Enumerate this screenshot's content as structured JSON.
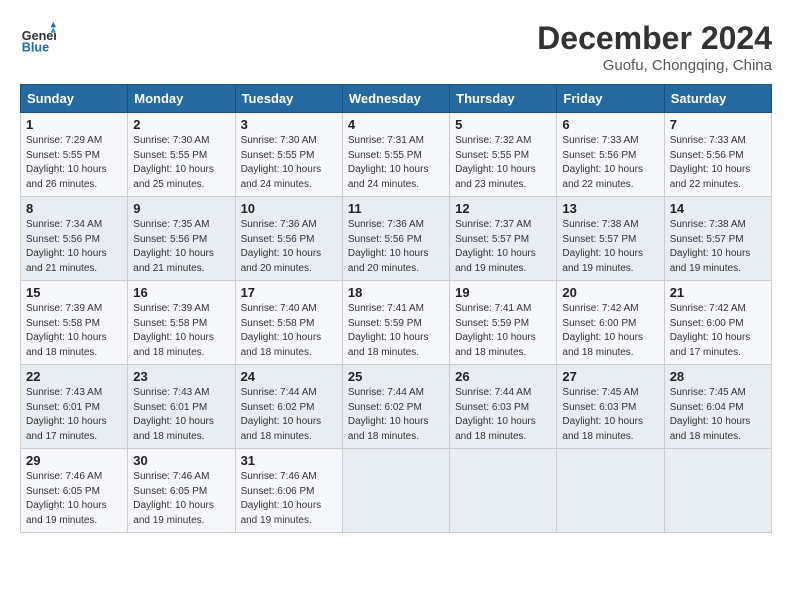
{
  "header": {
    "logo_line1": "General",
    "logo_line2": "Blue",
    "month": "December 2024",
    "location": "Guofu, Chongqing, China"
  },
  "weekdays": [
    "Sunday",
    "Monday",
    "Tuesday",
    "Wednesday",
    "Thursday",
    "Friday",
    "Saturday"
  ],
  "weeks": [
    [
      {
        "day": "1",
        "info": "Sunrise: 7:29 AM\nSunset: 5:55 PM\nDaylight: 10 hours\nand 26 minutes."
      },
      {
        "day": "2",
        "info": "Sunrise: 7:30 AM\nSunset: 5:55 PM\nDaylight: 10 hours\nand 25 minutes."
      },
      {
        "day": "3",
        "info": "Sunrise: 7:30 AM\nSunset: 5:55 PM\nDaylight: 10 hours\nand 24 minutes."
      },
      {
        "day": "4",
        "info": "Sunrise: 7:31 AM\nSunset: 5:55 PM\nDaylight: 10 hours\nand 24 minutes."
      },
      {
        "day": "5",
        "info": "Sunrise: 7:32 AM\nSunset: 5:55 PM\nDaylight: 10 hours\nand 23 minutes."
      },
      {
        "day": "6",
        "info": "Sunrise: 7:33 AM\nSunset: 5:56 PM\nDaylight: 10 hours\nand 22 minutes."
      },
      {
        "day": "7",
        "info": "Sunrise: 7:33 AM\nSunset: 5:56 PM\nDaylight: 10 hours\nand 22 minutes."
      }
    ],
    [
      {
        "day": "8",
        "info": "Sunrise: 7:34 AM\nSunset: 5:56 PM\nDaylight: 10 hours\nand 21 minutes."
      },
      {
        "day": "9",
        "info": "Sunrise: 7:35 AM\nSunset: 5:56 PM\nDaylight: 10 hours\nand 21 minutes."
      },
      {
        "day": "10",
        "info": "Sunrise: 7:36 AM\nSunset: 5:56 PM\nDaylight: 10 hours\nand 20 minutes."
      },
      {
        "day": "11",
        "info": "Sunrise: 7:36 AM\nSunset: 5:56 PM\nDaylight: 10 hours\nand 20 minutes."
      },
      {
        "day": "12",
        "info": "Sunrise: 7:37 AM\nSunset: 5:57 PM\nDaylight: 10 hours\nand 19 minutes."
      },
      {
        "day": "13",
        "info": "Sunrise: 7:38 AM\nSunset: 5:57 PM\nDaylight: 10 hours\nand 19 minutes."
      },
      {
        "day": "14",
        "info": "Sunrise: 7:38 AM\nSunset: 5:57 PM\nDaylight: 10 hours\nand 19 minutes."
      }
    ],
    [
      {
        "day": "15",
        "info": "Sunrise: 7:39 AM\nSunset: 5:58 PM\nDaylight: 10 hours\nand 18 minutes."
      },
      {
        "day": "16",
        "info": "Sunrise: 7:39 AM\nSunset: 5:58 PM\nDaylight: 10 hours\nand 18 minutes."
      },
      {
        "day": "17",
        "info": "Sunrise: 7:40 AM\nSunset: 5:58 PM\nDaylight: 10 hours\nand 18 minutes."
      },
      {
        "day": "18",
        "info": "Sunrise: 7:41 AM\nSunset: 5:59 PM\nDaylight: 10 hours\nand 18 minutes."
      },
      {
        "day": "19",
        "info": "Sunrise: 7:41 AM\nSunset: 5:59 PM\nDaylight: 10 hours\nand 18 minutes."
      },
      {
        "day": "20",
        "info": "Sunrise: 7:42 AM\nSunset: 6:00 PM\nDaylight: 10 hours\nand 18 minutes."
      },
      {
        "day": "21",
        "info": "Sunrise: 7:42 AM\nSunset: 6:00 PM\nDaylight: 10 hours\nand 17 minutes."
      }
    ],
    [
      {
        "day": "22",
        "info": "Sunrise: 7:43 AM\nSunset: 6:01 PM\nDaylight: 10 hours\nand 17 minutes."
      },
      {
        "day": "23",
        "info": "Sunrise: 7:43 AM\nSunset: 6:01 PM\nDaylight: 10 hours\nand 18 minutes."
      },
      {
        "day": "24",
        "info": "Sunrise: 7:44 AM\nSunset: 6:02 PM\nDaylight: 10 hours\nand 18 minutes."
      },
      {
        "day": "25",
        "info": "Sunrise: 7:44 AM\nSunset: 6:02 PM\nDaylight: 10 hours\nand 18 minutes."
      },
      {
        "day": "26",
        "info": "Sunrise: 7:44 AM\nSunset: 6:03 PM\nDaylight: 10 hours\nand 18 minutes."
      },
      {
        "day": "27",
        "info": "Sunrise: 7:45 AM\nSunset: 6:03 PM\nDaylight: 10 hours\nand 18 minutes."
      },
      {
        "day": "28",
        "info": "Sunrise: 7:45 AM\nSunset: 6:04 PM\nDaylight: 10 hours\nand 18 minutes."
      }
    ],
    [
      {
        "day": "29",
        "info": "Sunrise: 7:46 AM\nSunset: 6:05 PM\nDaylight: 10 hours\nand 19 minutes."
      },
      {
        "day": "30",
        "info": "Sunrise: 7:46 AM\nSunset: 6:05 PM\nDaylight: 10 hours\nand 19 minutes."
      },
      {
        "day": "31",
        "info": "Sunrise: 7:46 AM\nSunset: 6:06 PM\nDaylight: 10 hours\nand 19 minutes."
      },
      {
        "day": "",
        "info": ""
      },
      {
        "day": "",
        "info": ""
      },
      {
        "day": "",
        "info": ""
      },
      {
        "day": "",
        "info": ""
      }
    ]
  ]
}
